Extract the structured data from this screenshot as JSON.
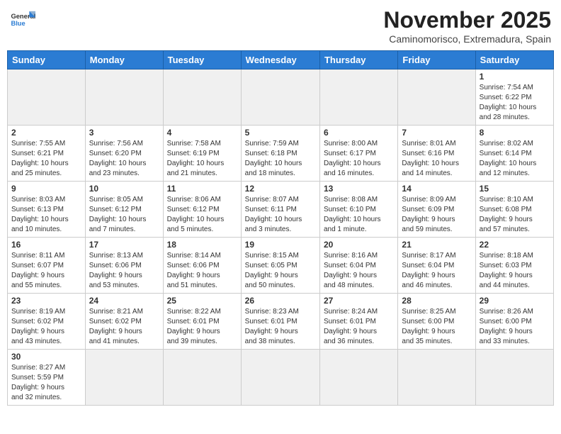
{
  "header": {
    "logo_general": "General",
    "logo_blue": "Blue",
    "month_title": "November 2025",
    "location": "Caminomorisco, Extremadura, Spain"
  },
  "days_of_week": [
    "Sunday",
    "Monday",
    "Tuesday",
    "Wednesday",
    "Thursday",
    "Friday",
    "Saturday"
  ],
  "weeks": [
    [
      {
        "day": "",
        "info": "",
        "empty": true
      },
      {
        "day": "",
        "info": "",
        "empty": true
      },
      {
        "day": "",
        "info": "",
        "empty": true
      },
      {
        "day": "",
        "info": "",
        "empty": true
      },
      {
        "day": "",
        "info": "",
        "empty": true
      },
      {
        "day": "",
        "info": "",
        "empty": true
      },
      {
        "day": "1",
        "info": "Sunrise: 7:54 AM\nSunset: 6:22 PM\nDaylight: 10 hours\nand 28 minutes."
      }
    ],
    [
      {
        "day": "2",
        "info": "Sunrise: 7:55 AM\nSunset: 6:21 PM\nDaylight: 10 hours\nand 25 minutes."
      },
      {
        "day": "3",
        "info": "Sunrise: 7:56 AM\nSunset: 6:20 PM\nDaylight: 10 hours\nand 23 minutes."
      },
      {
        "day": "4",
        "info": "Sunrise: 7:58 AM\nSunset: 6:19 PM\nDaylight: 10 hours\nand 21 minutes."
      },
      {
        "day": "5",
        "info": "Sunrise: 7:59 AM\nSunset: 6:18 PM\nDaylight: 10 hours\nand 18 minutes."
      },
      {
        "day": "6",
        "info": "Sunrise: 8:00 AM\nSunset: 6:17 PM\nDaylight: 10 hours\nand 16 minutes."
      },
      {
        "day": "7",
        "info": "Sunrise: 8:01 AM\nSunset: 6:16 PM\nDaylight: 10 hours\nand 14 minutes."
      },
      {
        "day": "8",
        "info": "Sunrise: 8:02 AM\nSunset: 6:14 PM\nDaylight: 10 hours\nand 12 minutes."
      }
    ],
    [
      {
        "day": "9",
        "info": "Sunrise: 8:03 AM\nSunset: 6:13 PM\nDaylight: 10 hours\nand 10 minutes."
      },
      {
        "day": "10",
        "info": "Sunrise: 8:05 AM\nSunset: 6:12 PM\nDaylight: 10 hours\nand 7 minutes."
      },
      {
        "day": "11",
        "info": "Sunrise: 8:06 AM\nSunset: 6:12 PM\nDaylight: 10 hours\nand 5 minutes."
      },
      {
        "day": "12",
        "info": "Sunrise: 8:07 AM\nSunset: 6:11 PM\nDaylight: 10 hours\nand 3 minutes."
      },
      {
        "day": "13",
        "info": "Sunrise: 8:08 AM\nSunset: 6:10 PM\nDaylight: 10 hours\nand 1 minute."
      },
      {
        "day": "14",
        "info": "Sunrise: 8:09 AM\nSunset: 6:09 PM\nDaylight: 9 hours\nand 59 minutes."
      },
      {
        "day": "15",
        "info": "Sunrise: 8:10 AM\nSunset: 6:08 PM\nDaylight: 9 hours\nand 57 minutes."
      }
    ],
    [
      {
        "day": "16",
        "info": "Sunrise: 8:11 AM\nSunset: 6:07 PM\nDaylight: 9 hours\nand 55 minutes."
      },
      {
        "day": "17",
        "info": "Sunrise: 8:13 AM\nSunset: 6:06 PM\nDaylight: 9 hours\nand 53 minutes."
      },
      {
        "day": "18",
        "info": "Sunrise: 8:14 AM\nSunset: 6:06 PM\nDaylight: 9 hours\nand 51 minutes."
      },
      {
        "day": "19",
        "info": "Sunrise: 8:15 AM\nSunset: 6:05 PM\nDaylight: 9 hours\nand 50 minutes."
      },
      {
        "day": "20",
        "info": "Sunrise: 8:16 AM\nSunset: 6:04 PM\nDaylight: 9 hours\nand 48 minutes."
      },
      {
        "day": "21",
        "info": "Sunrise: 8:17 AM\nSunset: 6:04 PM\nDaylight: 9 hours\nand 46 minutes."
      },
      {
        "day": "22",
        "info": "Sunrise: 8:18 AM\nSunset: 6:03 PM\nDaylight: 9 hours\nand 44 minutes."
      }
    ],
    [
      {
        "day": "23",
        "info": "Sunrise: 8:19 AM\nSunset: 6:02 PM\nDaylight: 9 hours\nand 43 minutes."
      },
      {
        "day": "24",
        "info": "Sunrise: 8:21 AM\nSunset: 6:02 PM\nDaylight: 9 hours\nand 41 minutes."
      },
      {
        "day": "25",
        "info": "Sunrise: 8:22 AM\nSunset: 6:01 PM\nDaylight: 9 hours\nand 39 minutes."
      },
      {
        "day": "26",
        "info": "Sunrise: 8:23 AM\nSunset: 6:01 PM\nDaylight: 9 hours\nand 38 minutes."
      },
      {
        "day": "27",
        "info": "Sunrise: 8:24 AM\nSunset: 6:01 PM\nDaylight: 9 hours\nand 36 minutes."
      },
      {
        "day": "28",
        "info": "Sunrise: 8:25 AM\nSunset: 6:00 PM\nDaylight: 9 hours\nand 35 minutes."
      },
      {
        "day": "29",
        "info": "Sunrise: 8:26 AM\nSunset: 6:00 PM\nDaylight: 9 hours\nand 33 minutes."
      }
    ],
    [
      {
        "day": "30",
        "info": "Sunrise: 8:27 AM\nSunset: 5:59 PM\nDaylight: 9 hours\nand 32 minutes."
      },
      {
        "day": "",
        "info": "",
        "empty": true
      },
      {
        "day": "",
        "info": "",
        "empty": true
      },
      {
        "day": "",
        "info": "",
        "empty": true
      },
      {
        "day": "",
        "info": "",
        "empty": true
      },
      {
        "day": "",
        "info": "",
        "empty": true
      },
      {
        "day": "",
        "info": "",
        "empty": true
      }
    ]
  ]
}
